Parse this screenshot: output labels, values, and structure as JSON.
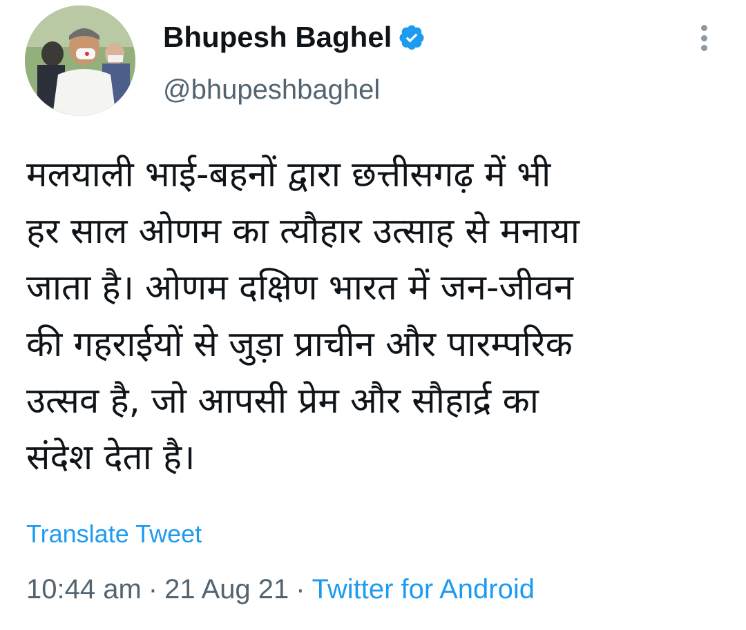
{
  "author": {
    "name": "Bhupesh Baghel",
    "handle": "@bhupeshbaghel",
    "verified": true
  },
  "tweet": {
    "text_lines": [
      "मलयाली भाई-बहनों द्वारा छत्तीसगढ़ में भी",
      "हर साल ओणम का त्यौहार उत्साह से मनाया",
      "जाता है। ओणम दक्षिण भारत में जन-जीवन",
      "की गहराईयों से जुड़ा प्राचीन और पारम्परिक",
      "उत्सव है, जो आपसी प्रेम और सौहार्द्र का",
      "संदेश देता है।"
    ],
    "translate_label": "Translate Tweet",
    "time": "10:44 am",
    "separator": "·",
    "date": "21 Aug 21",
    "source": "Twitter for Android"
  },
  "icons": {
    "verified": "verified-badge-icon",
    "more": "more-options-icon"
  },
  "colors": {
    "accent": "#1d9bf0",
    "text": "#0f1419",
    "secondary": "#536471"
  }
}
